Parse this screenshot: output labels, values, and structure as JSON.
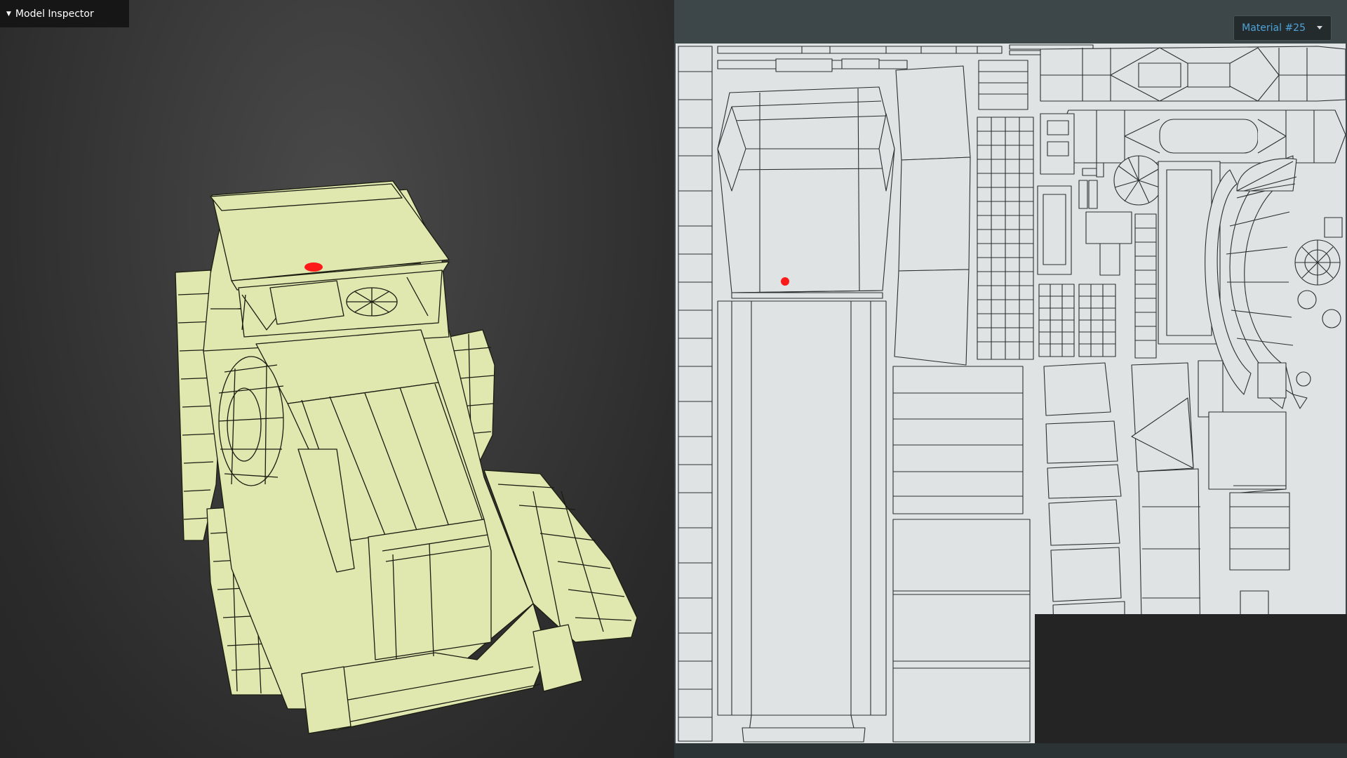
{
  "inspector": {
    "title": "Model Inspector"
  },
  "material": {
    "selected": "Material #25"
  },
  "colors": {
    "mesh_fill": "#e0e8b0",
    "wire": "#1a1c10",
    "uv_fill": "#dfe3e4",
    "marker": "#ff1a1a",
    "accent": "#4fa3d8"
  },
  "icons": {
    "caret": "caret-down-icon",
    "dropdown": "chevron-down-icon"
  }
}
